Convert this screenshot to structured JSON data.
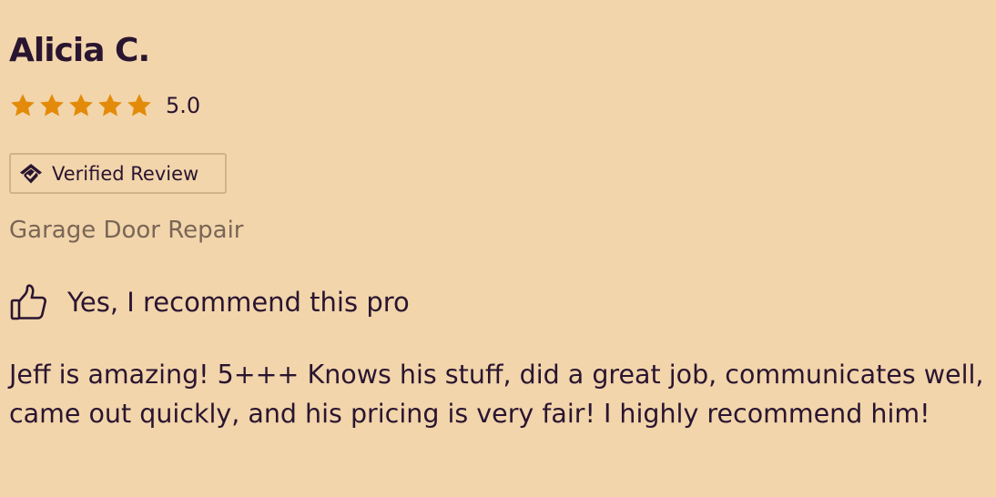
{
  "review": {
    "reviewer_name": "Alicia C.",
    "rating": {
      "value": 5.0,
      "value_label": "5.0",
      "max": 5,
      "star_color": "#e38b09"
    },
    "verified_badge": {
      "label": "Verified Review",
      "icon": "home-check-icon"
    },
    "service": "Garage Door Repair",
    "recommendation": {
      "label": "Yes, I recommend this pro",
      "icon": "thumbs-up-icon"
    },
    "body": "Jeff is amazing! 5+++ Knows his stuff, did a great job, communicates well, came out quickly, and his pricing is very fair! I highly recommend him!"
  },
  "colors": {
    "background": "#f2d5ab",
    "text_primary": "#2a1530",
    "text_secondary": "#7a6656",
    "badge_border": "#d2b28a",
    "star": "#e38b09"
  }
}
